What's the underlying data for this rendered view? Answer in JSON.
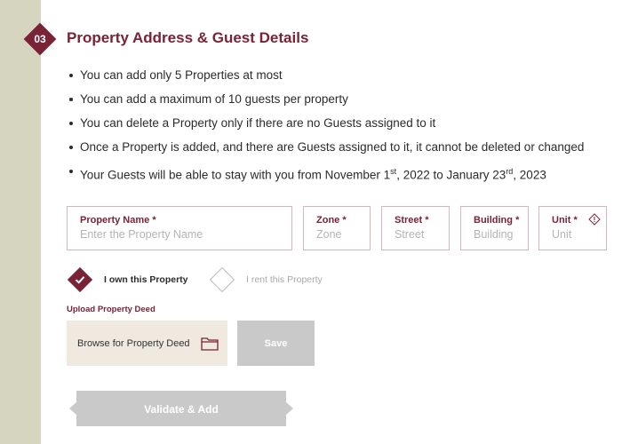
{
  "section": {
    "step_number": "03",
    "title": "Property Address & Guest Details"
  },
  "rules": [
    {
      "text": "You can add only 5 Properties at most"
    },
    {
      "text": "You can add a maximum of 10 guests per property"
    },
    {
      "text": "You can delete a Property only if there are no Guests assigned to it"
    },
    {
      "text": "Once a Property is added, and there are Guests assigned to it, it cannot be deleted or changed"
    },
    {
      "pre": "Your Guests will be able to stay with you from November 1",
      "sup1": "st",
      "mid": ", 2022 to January 23",
      "sup2": "rd",
      "post": ", 2023"
    }
  ],
  "fields": {
    "property_name": {
      "label": "Property Name",
      "required": "*",
      "placeholder": "Enter the Property Name",
      "value": ""
    },
    "zone": {
      "label": "Zone",
      "required": "*",
      "placeholder": "Zone",
      "value": ""
    },
    "street": {
      "label": "Street",
      "required": "*",
      "placeholder": "Street",
      "value": ""
    },
    "building": {
      "label": "Building",
      "required": "*",
      "placeholder": "Building",
      "value": ""
    },
    "unit": {
      "label": "Unit",
      "required": "*",
      "placeholder": "Unit",
      "value": "",
      "icon": "info-icon"
    }
  },
  "ownership": {
    "own_label": "I own this Property",
    "rent_label": "I rent this Property",
    "selected": "own"
  },
  "upload": {
    "label": "Upload Property Deed",
    "browse_label": "Browse for Property Deed",
    "browse_icon": "folder-icon",
    "save_label": "Save"
  },
  "actions": {
    "validate_label": "Validate & Add"
  },
  "colors": {
    "accent": "#7a2236",
    "side_strip": "#d6d5bf",
    "field_border": "#d9b3bd",
    "disabled": "#c9c9c9",
    "browse_bg": "#efe9df"
  }
}
